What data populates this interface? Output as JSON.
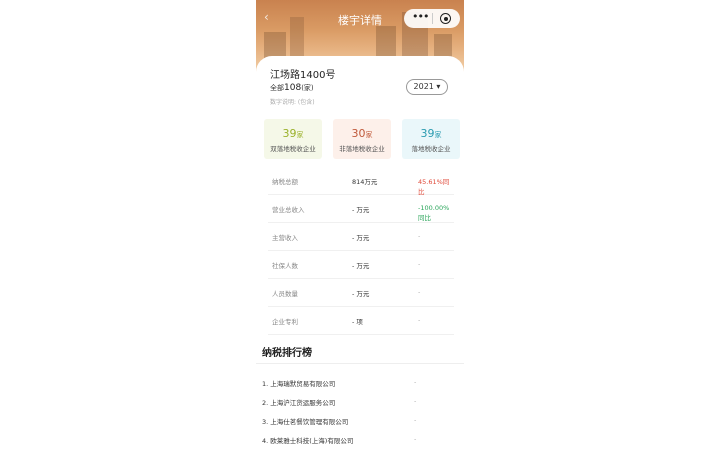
{
  "header": {
    "title": "楼宇详情",
    "back_icon": "chevron-left-icon",
    "capsule": {
      "menu_icon": "more-dots-icon",
      "close_icon": "target-icon"
    }
  },
  "building": {
    "address": "江场路1400号",
    "count_prefix": "全部",
    "count_value": "108",
    "count_suffix": "(家)",
    "note": "数字说明: (包含)",
    "year": "2021 ▾"
  },
  "stats": [
    {
      "value": "39",
      "unit": "家",
      "label": "双落地税收企业",
      "color": "#9ab12a"
    },
    {
      "value": "30",
      "unit": "家",
      "label": "非落地税收企业",
      "color": "#c0593a"
    },
    {
      "value": "39",
      "unit": "家",
      "label": "落地税收企业",
      "color": "#2a9bb0"
    }
  ],
  "metrics": [
    {
      "label": "纳税总额",
      "value": "814万元",
      "change": "45.61%同比"
    },
    {
      "label": "营业总收入",
      "value": "- 万元",
      "change": "-100.00%同比"
    },
    {
      "label": "主营收入",
      "value": "- 万元",
      "change": "-"
    },
    {
      "label": "社保人数",
      "value": "- 万元",
      "change": "-"
    },
    {
      "label": "人员数量",
      "value": "- 万元",
      "change": "-"
    },
    {
      "label": "企业专利",
      "value": "- 项",
      "change": "-"
    }
  ],
  "ranking": {
    "title": "纳税排行榜",
    "items": [
      {
        "name": "1. 上海瑞默贸易有限公司",
        "value": "-"
      },
      {
        "name": "2. 上海沪江货运服务公司",
        "value": "-"
      },
      {
        "name": "3. 上海仕茗餐饮管理有限公司",
        "value": "-"
      },
      {
        "name": "4. 欧莱雅士科技(上海)有限公司",
        "value": "-"
      }
    ]
  }
}
